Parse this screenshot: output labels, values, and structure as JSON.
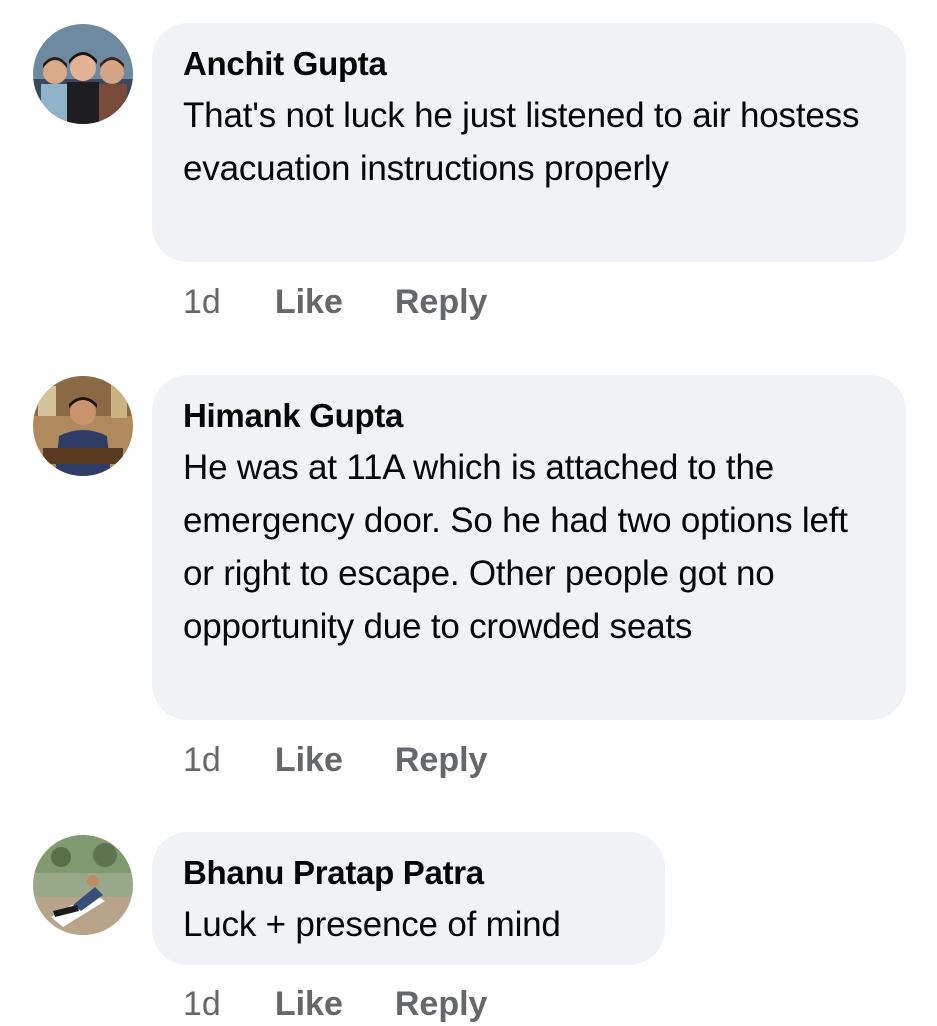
{
  "comments": [
    {
      "author": "Anchit Gupta",
      "text": "That's not luck he just listened to air hostess evacuation instructions properly",
      "time": "1d",
      "like_label": "Like",
      "reply_label": "Reply"
    },
    {
      "author": "Himank Gupta",
      "text": "He was at 11A which is attached to the emergency door. So he had two options left or right to escape. Other people got no opportunity due to crowded seats",
      "time": "1d",
      "like_label": "Like",
      "reply_label": "Reply"
    },
    {
      "author": "Bhanu Pratap Patra",
      "text": "Luck + presence of mind",
      "time": "1d",
      "like_label": "Like",
      "reply_label": "Reply"
    }
  ],
  "colors": {
    "bubble": "#f0f2f5",
    "text": "#050505",
    "secondary": "#65676b"
  }
}
